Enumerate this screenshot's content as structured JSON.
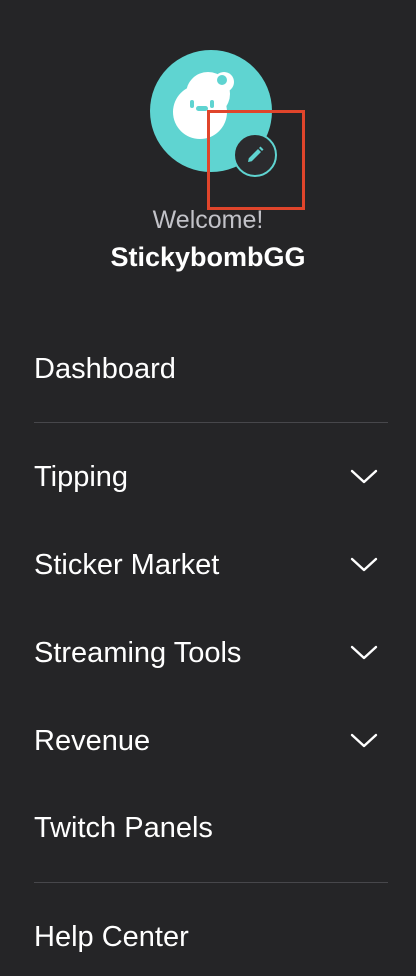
{
  "profile": {
    "welcome_text": "Welcome!",
    "username": "StickybombGG",
    "avatar_icon": "bear-face-icon",
    "edit_icon": "pencil-icon"
  },
  "menu": {
    "items": [
      {
        "label": "Dashboard",
        "expandable": false
      },
      {
        "label": "Tipping",
        "expandable": true,
        "icon": "chevron-down-icon"
      },
      {
        "label": "Sticker Market",
        "expandable": true,
        "icon": "chevron-down-icon"
      },
      {
        "label": "Streaming Tools",
        "expandable": true,
        "icon": "chevron-down-icon"
      },
      {
        "label": "Revenue",
        "expandable": true,
        "icon": "chevron-down-icon"
      },
      {
        "label": "Twitch Panels",
        "expandable": false
      },
      {
        "label": "Help Center",
        "expandable": false
      }
    ]
  },
  "colors": {
    "background": "#252527",
    "accent": "#5fd4d1",
    "highlight": "#e0452b",
    "text": "#ffffff",
    "muted_text": "#c2c2c8",
    "divider": "#47474b"
  }
}
